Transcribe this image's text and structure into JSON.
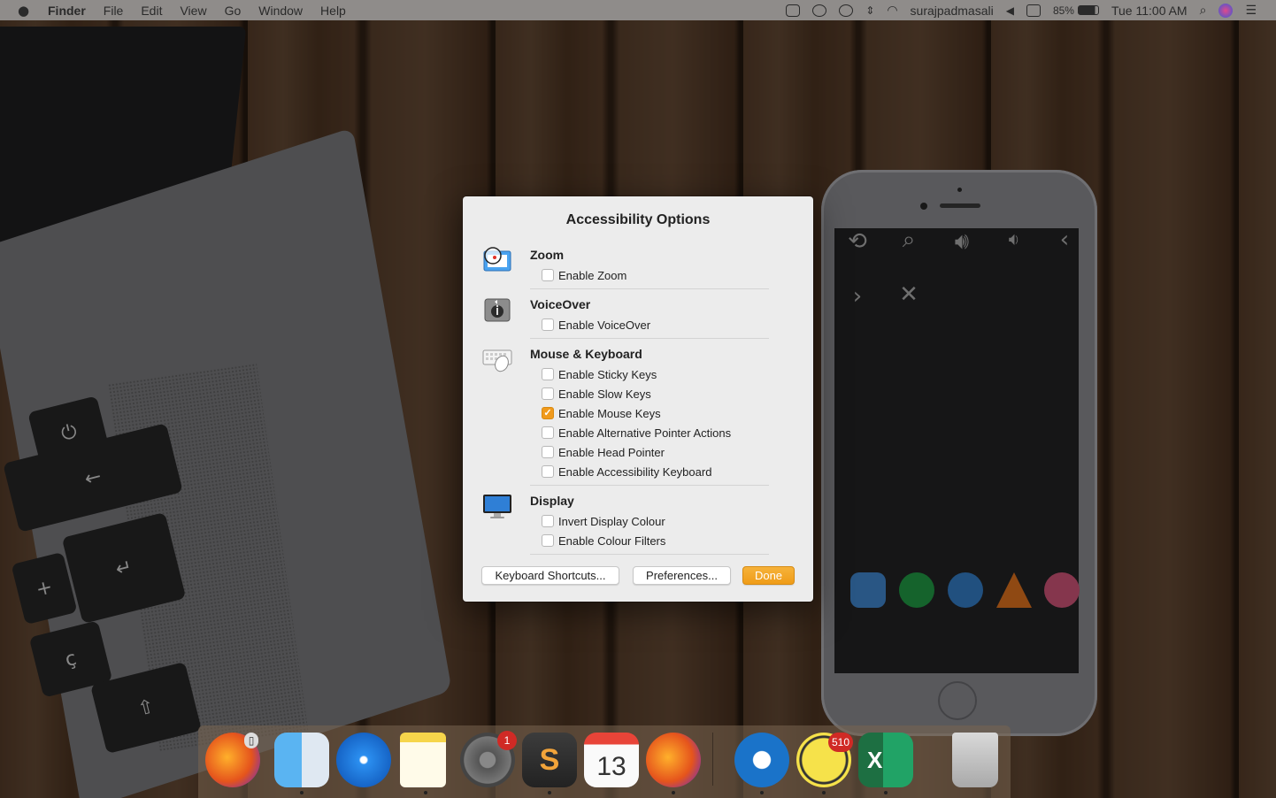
{
  "menubar": {
    "apple_icon": "apple-icon",
    "menus": [
      "Finder",
      "File",
      "Edit",
      "View",
      "Go",
      "Window",
      "Help"
    ],
    "username": "surajpadmasali",
    "battery": "85%",
    "clock": "Tue 11:00 AM"
  },
  "dialog": {
    "title": "Accessibility Options",
    "sections": [
      {
        "title": "Zoom",
        "icon": "zoom-icon",
        "options": [
          {
            "label": "Enable Zoom",
            "checked": false
          }
        ]
      },
      {
        "title": "VoiceOver",
        "icon": "voiceover-icon",
        "options": [
          {
            "label": "Enable VoiceOver",
            "checked": false
          }
        ]
      },
      {
        "title": "Mouse & Keyboard",
        "icon": "mouse-keyboard-icon",
        "options": [
          {
            "label": "Enable Sticky Keys",
            "checked": false
          },
          {
            "label": "Enable Slow Keys",
            "checked": false
          },
          {
            "label": "Enable Mouse Keys",
            "checked": true
          },
          {
            "label": "Enable Alternative Pointer Actions",
            "checked": false
          },
          {
            "label": "Enable Head Pointer",
            "checked": false
          },
          {
            "label": "Enable Accessibility Keyboard",
            "checked": false
          }
        ]
      },
      {
        "title": "Display",
        "icon": "display-icon",
        "options": [
          {
            "label": "Invert Display Colour",
            "checked": false
          },
          {
            "label": "Enable Colour Filters",
            "checked": false
          }
        ]
      }
    ],
    "buttons": {
      "shortcuts": "Keyboard Shortcuts...",
      "preferences": "Preferences...",
      "done": "Done"
    }
  },
  "dock": {
    "items": [
      "firefox",
      "finder",
      "safari",
      "notes",
      "system-preferences",
      "sublime-text",
      "calendar",
      "firefox",
      "teamviewer",
      "basecamp",
      "excel",
      "trash"
    ],
    "calendar_day": "13",
    "badges": {
      "system_preferences": "1",
      "basecamp": "510"
    }
  },
  "colors": {
    "accent": "#f09a1c",
    "dialog_bg": "#ececec"
  }
}
